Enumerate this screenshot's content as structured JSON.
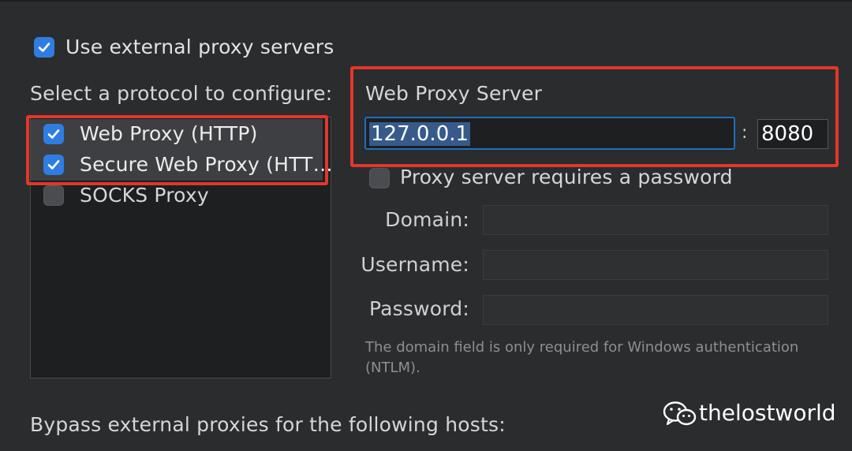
{
  "use_external_proxy": {
    "label": "Use external proxy servers",
    "checked": true
  },
  "protocol_section": {
    "label": "Select a protocol to configure:"
  },
  "protocols": [
    {
      "label": "Web Proxy (HTTP)",
      "checked": true,
      "selected": true
    },
    {
      "label": "Secure Web Proxy (HTT…",
      "checked": true,
      "selected": true
    },
    {
      "label": "SOCKS Proxy",
      "checked": false,
      "selected": false
    }
  ],
  "server": {
    "heading": "Web Proxy Server",
    "host_value": "127.0.0.1",
    "separator": ":",
    "port_value": "8080",
    "requires_password_label": "Proxy server requires a password",
    "requires_password_checked": false
  },
  "auth": {
    "domain_label": "Domain:",
    "domain_value": "",
    "username_label": "Username:",
    "username_value": "",
    "password_label": "Password:",
    "password_value": ""
  },
  "hint_text": "The domain field is only required for Windows authentication (NTLM).",
  "bypass_label": "Bypass external proxies for the following hosts:",
  "watermark": {
    "text": "thelostworld",
    "icon": "wechat-icon"
  },
  "colors": {
    "accent": "#2f7de1",
    "highlight_border": "#e2372b",
    "background": "#2a2c2e",
    "selection": "#375a8a"
  }
}
